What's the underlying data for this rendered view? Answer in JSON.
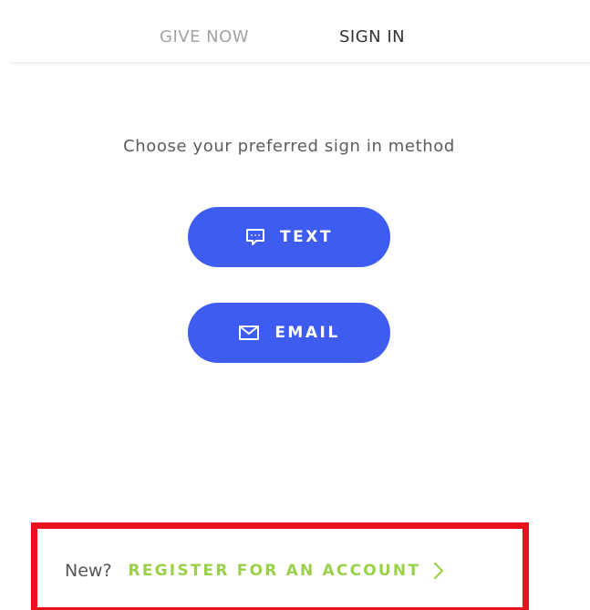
{
  "nav": {
    "tabs": [
      {
        "label": "GIVE NOW",
        "active": false
      },
      {
        "label": "SIGN IN",
        "active": true
      }
    ]
  },
  "signin": {
    "prompt": "Choose your preferred sign in method",
    "methods": [
      {
        "label": "TEXT",
        "icon": "chat-bubble-icon"
      },
      {
        "label": "EMAIL",
        "icon": "envelope-icon"
      }
    ]
  },
  "register": {
    "new_label": "New?",
    "link_label": "REGISTER FOR AN ACCOUNT",
    "icon": "chevron-right-icon"
  },
  "colors": {
    "primary_button": "#3f5cf0",
    "register_link": "#9ad14b",
    "highlight_box": "#e8121c",
    "inactive_tab": "#a3a3a3",
    "active_tab": "#333333"
  }
}
